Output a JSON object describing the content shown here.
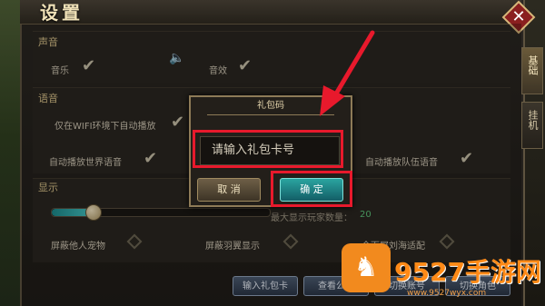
{
  "header": {
    "title": "设置"
  },
  "sections": {
    "sound": {
      "title": "声音",
      "music": "音乐",
      "sfx": "音效"
    },
    "voice": {
      "title": "语音",
      "wifi_autoplay": "仅在WIFI环境下自动播放",
      "world_autoplay": "自动播放世界语音",
      "team_autoplay": "自动播放队伍语音"
    },
    "display": {
      "title": "显示",
      "max_players_label": "最大显示玩家数量：",
      "max_players_value": "20",
      "slider_level": 0.19,
      "hide_pets": "屏蔽他人宠物",
      "hide_wings": "屏蔽羽翼显示",
      "fullscreen_fit": "全面屏刘海适配"
    }
  },
  "side_tabs": [
    "基础",
    "挂机"
  ],
  "bottom_buttons": {
    "gift_code": "输入礼包卡",
    "announcement": "查看公告",
    "switch_account": "切换账号",
    "switch_role": "切换角色"
  },
  "dialog": {
    "title": "礼包码",
    "input_placeholder": "请输入礼包卡号",
    "cancel": "取 消",
    "confirm": "确 定"
  },
  "watermark": {
    "brand": "9527手游网",
    "url": "www.9527wyx.com"
  },
  "colors": {
    "highlight": "#e8192c",
    "confirm": "#2aa4a0",
    "watermark": "#ff8a17"
  }
}
